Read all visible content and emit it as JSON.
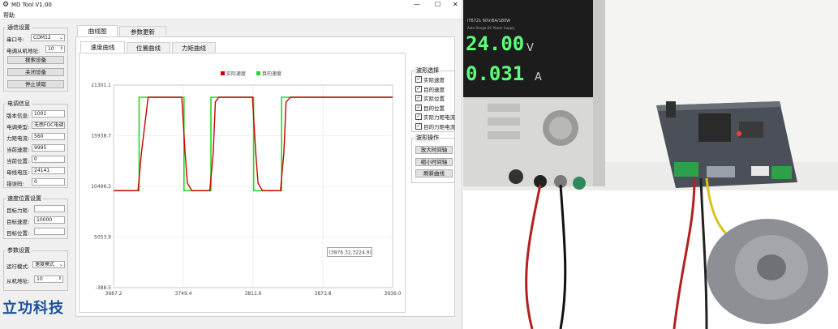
{
  "window": {
    "title": "MD Tool V1.00",
    "minimize_glyph": "—",
    "maximize_glyph": "☐",
    "close_glyph": "✕"
  },
  "menu": {
    "help": "帮助"
  },
  "comm": {
    "title": "通信设置",
    "port_label": "串口号:",
    "port_value": "COM12",
    "address_label": "电调从机地址:",
    "address_value": "10",
    "search_button": "搜索设备",
    "close_button": "关闭设备",
    "stop_button": "停止读取"
  },
  "esc_info": {
    "title": "电调信息",
    "rows": [
      {
        "label": "版本信息:",
        "value": "1001"
      },
      {
        "label": "电调类型:",
        "value": "无感FOC电调"
      },
      {
        "label": "力矩电流:",
        "value": "560"
      },
      {
        "label": "当前速度:",
        "value": "9995"
      },
      {
        "label": "当前位置:",
        "value": "0"
      },
      {
        "label": "母线电压:",
        "value": "24141"
      },
      {
        "label": "错误码:",
        "value": "0"
      }
    ]
  },
  "speed_pos": {
    "title": "速度位置设置",
    "rows": [
      {
        "label": "目标力矩:",
        "value": ""
      },
      {
        "label": "目标速度:",
        "value": "10000"
      },
      {
        "label": "目标位置:",
        "value": ""
      }
    ]
  },
  "params": {
    "title": "参数设置",
    "mode_label": "运行模式:",
    "mode_value": "速度模式",
    "slave_label": "从机地址:",
    "slave_value": "10"
  },
  "logo": {
    "text": "立功科技"
  },
  "tabs": {
    "main": [
      "曲线图",
      "参数更新"
    ],
    "sub": [
      "速度曲线",
      "位置曲线",
      "力矩曲线"
    ]
  },
  "chart_data": {
    "type": "line",
    "title": "",
    "legend": [
      "实际速度",
      "目的速度"
    ],
    "legend_placement": "top-center",
    "colors": {
      "actual": "#cc0000",
      "target": "#22dd22"
    },
    "x_ticks": [
      "3687.2",
      "3749.4",
      "3811.6",
      "3873.8",
      "3936.0"
    ],
    "y_ticks": [
      "21301.1",
      "15938.7",
      "10496.3",
      "5053.9",
      "-388.5"
    ],
    "xlim": [
      3687.2,
      3936.0
    ],
    "ylim": [
      -388.5,
      21301.1
    ],
    "grid": true,
    "series": [
      {
        "name": "实际速度",
        "x": [
          3687.2,
          3709,
          3712,
          3718,
          3748,
          3751,
          3753,
          3757,
          3773,
          3776,
          3778,
          3781,
          3811,
          3814,
          3816,
          3820,
          3836,
          3839,
          3841,
          3845,
          3936.0
        ],
        "y": [
          10000,
          10000,
          14000,
          20000,
          20000,
          14000,
          10800,
          10000,
          10000,
          14000,
          19500,
          20000,
          20000,
          14000,
          10800,
          10000,
          10000,
          14000,
          19500,
          20000,
          20000
        ]
      },
      {
        "name": "目的速度",
        "x": [
          3687.2,
          3710,
          3710,
          3750,
          3750,
          3774,
          3774,
          3812,
          3812,
          3837,
          3837,
          3936.0
        ],
        "y": [
          10000,
          10000,
          20000,
          20000,
          10000,
          10000,
          20000,
          20000,
          10000,
          10000,
          20000,
          20000
        ]
      }
    ],
    "tooltip": "(3876.32,3224.9)"
  },
  "waveform_select": {
    "title": "波形选择",
    "items": [
      "实际速度",
      "目的速度",
      "实际位置",
      "目的位置",
      "实际力矩电流",
      "目的力矩电流"
    ]
  },
  "waveform_ops": {
    "title": "波形操作",
    "buttons": [
      "放大时间轴",
      "缩小时间轴",
      "刷新曲线"
    ]
  },
  "psu": {
    "model": "IT6721 60V/8A/180W",
    "subtitle": "Auto Range DC Power Supply",
    "voltage": "24.00",
    "voltage_unit": "V",
    "current": "0.031",
    "current_unit": "A"
  }
}
